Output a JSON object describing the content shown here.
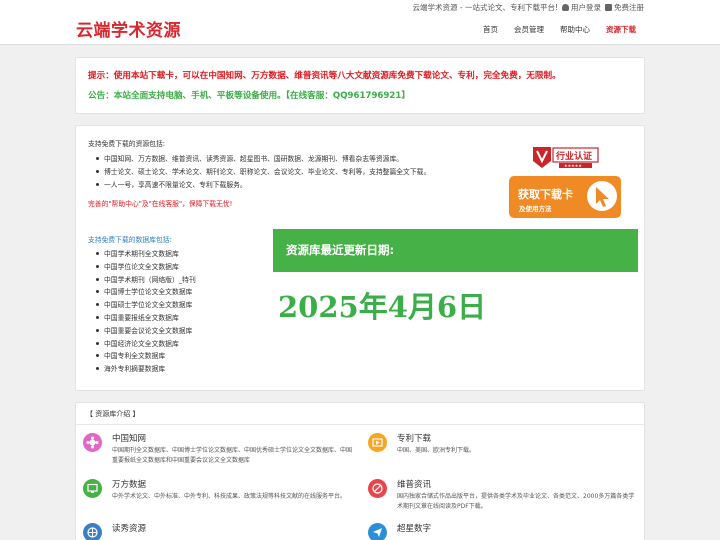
{
  "header": {
    "logo": "云端学术资源",
    "tagline": "云端学术资源 - 一站式论文、专利下载平台!",
    "login": "用户登录",
    "register": "免费注册",
    "nav": [
      "首页",
      "会员管理",
      "帮助中心",
      "资源下载"
    ]
  },
  "notice": {
    "tip": "提示：使用本站下载卡，可以在中国知网、万方数据、维普资讯等八大文献资源库免费下载论文、专利，完全免费，无限制。",
    "announce": "公告：本站全面支持电脑、手机、平板等设备使用。【在线客服：QQ961796921】"
  },
  "info": {
    "support_title": "支持免费下载的资源包括:",
    "support_items": [
      "中国知网、万方数据、维普资讯、读秀资源、超星图书、国研数据、龙源期刊、博看杂志等资源库。",
      "博士论文、硕士论文、学术论文、期刊论文、职称论文、会议论文、毕业论文、专利等，支持整篇全文下载。",
      "一人一号，享高速不限量论文、专利下载服务。"
    ],
    "red_note": "完善的\"帮助中心\"及\"在线客服\"，保障下载无忧!",
    "db_title": "支持免费下载的数据库包括:",
    "db_items": [
      "中国学术期刊全文数据库",
      "中国学位论文全文数据库",
      "中国学术期刊（网络版）_特刊",
      "中国博士学位论文全文数据库",
      "中国硕士学位论文全文数据库",
      "中国重要报纸全文数据库",
      "中国重要会议论文全文数据库",
      "中国经济论文全文数据库",
      "中国专利全文数据库",
      "海外专利摘要数据库"
    ],
    "badge": "行业认证",
    "download_card": "获取下载卡",
    "download_sub": "及使用方法",
    "update_label": "资源库最近更新日期:",
    "update_date": "2025年4月6日"
  },
  "intro": {
    "title": "【 资源库介绍 】",
    "items": [
      {
        "name": "中国知网",
        "desc": "中国期刊全文数据库、中国博士学位论文数据库、中国优秀硕士学位论文全文数据库、中国重要报纸全文数据库和中国重要会议论文全文数据库",
        "color": "#e066c8"
      },
      {
        "name": "专利下载",
        "desc": "中国、美国、欧洲专利下载。",
        "color": "#f5a623"
      },
      {
        "name": "万方数据",
        "desc": "中外学术论文、中外标准、中外专利、科技成果、政策法规等科技文献的在线服务平台。",
        "color": "#46b147"
      },
      {
        "name": "维普资讯",
        "desc": "国内独家合储式作品出版平台，提供各类学术及毕业论文、各类范文、2000多万篇各类学术期刊文章在线阅读及PDF下载。",
        "color": "#e8444a"
      },
      {
        "name": "读秀资源",
        "desc": "",
        "color": "#3a7fc4"
      },
      {
        "name": "超星数字",
        "desc": "",
        "color": "#2c8fd6"
      }
    ]
  },
  "colors": {
    "accent_red": "#d9272e",
    "green": "#46b147",
    "orange": "#f08a24"
  }
}
